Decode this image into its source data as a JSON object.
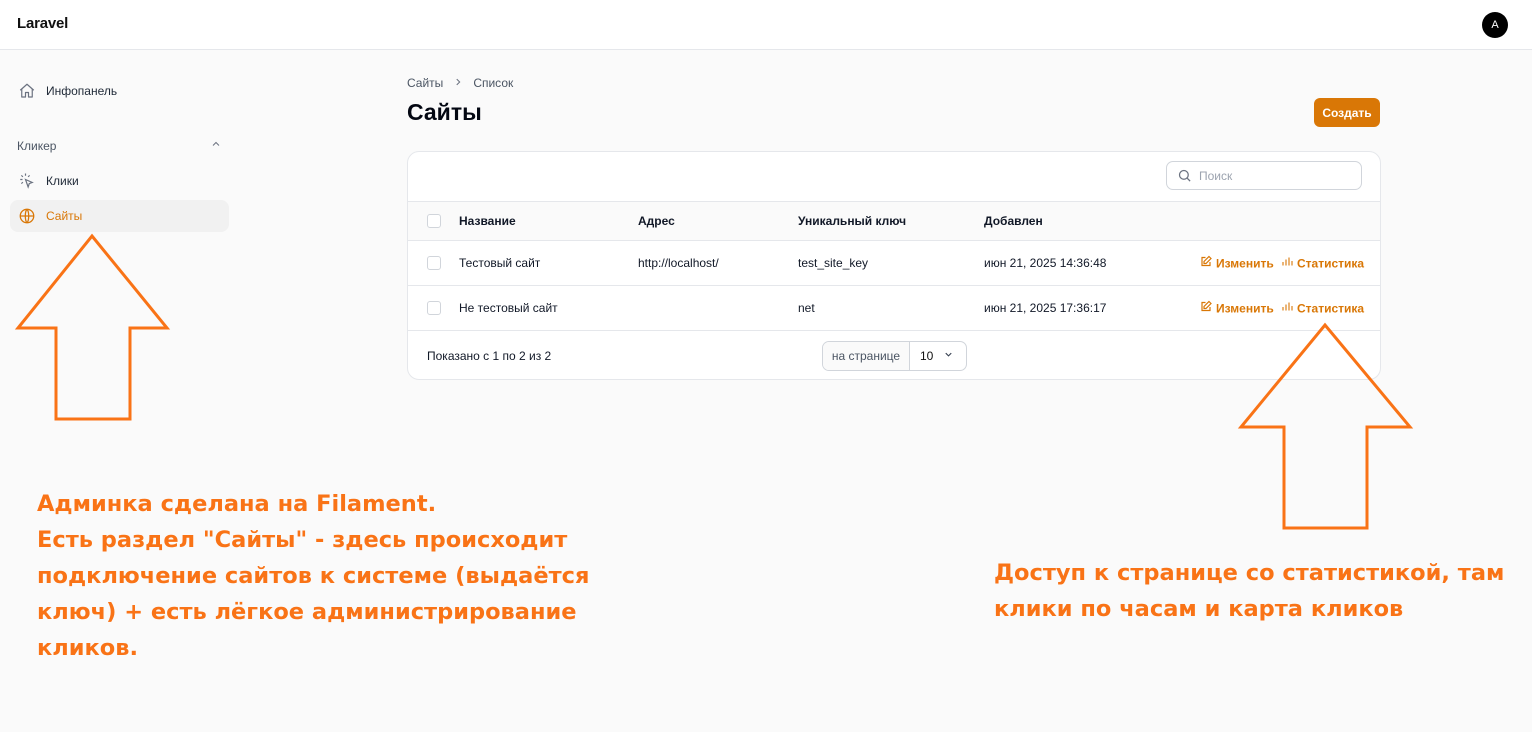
{
  "app": {
    "brand": "Laravel",
    "user_initial": "A"
  },
  "sidebar": {
    "dashboard_label": "Инфопанель",
    "group_label": "Кликер",
    "items": [
      {
        "label": "Клики",
        "icon": "cursor-click-icon"
      },
      {
        "label": "Сайты",
        "icon": "globe-icon",
        "active": true
      }
    ]
  },
  "breadcrumb": {
    "root": "Сайты",
    "separator": ">",
    "current": "Список"
  },
  "page": {
    "title": "Сайты",
    "create_label": "Создать"
  },
  "table": {
    "search_placeholder": "Поиск",
    "columns": [
      "Название",
      "Адрес",
      "Уникальный ключ",
      "Добавлен"
    ],
    "rows": [
      {
        "name": "Тестовый сайт",
        "address": "http://localhost/",
        "key": "test_site_key",
        "added": "июн 21, 2025 14:36:48"
      },
      {
        "name": "Не тестовый сайт",
        "address": "",
        "key": "net",
        "added": "июн 21, 2025 17:36:17"
      }
    ],
    "edit_label": "Изменить",
    "stats_label": "Статистика",
    "footer_text": "Показано с 1 по 2 из 2",
    "per_page_label": "на странице",
    "per_page_value": "10"
  },
  "annotations": {
    "left_lines": [
      "Админка сделана на Filament.",
      "Есть раздел \"Сайты\" - здесь происходит",
      "подключение сайтов к системе (выдаётся",
      "ключ) + есть лёгкое администрирование",
      "кликов."
    ],
    "right_lines": [
      "Доступ к странице со статистикой, там",
      "клики по часам и карта кликов"
    ]
  },
  "colors": {
    "accent": "#d97706",
    "annotation": "#f97316"
  }
}
